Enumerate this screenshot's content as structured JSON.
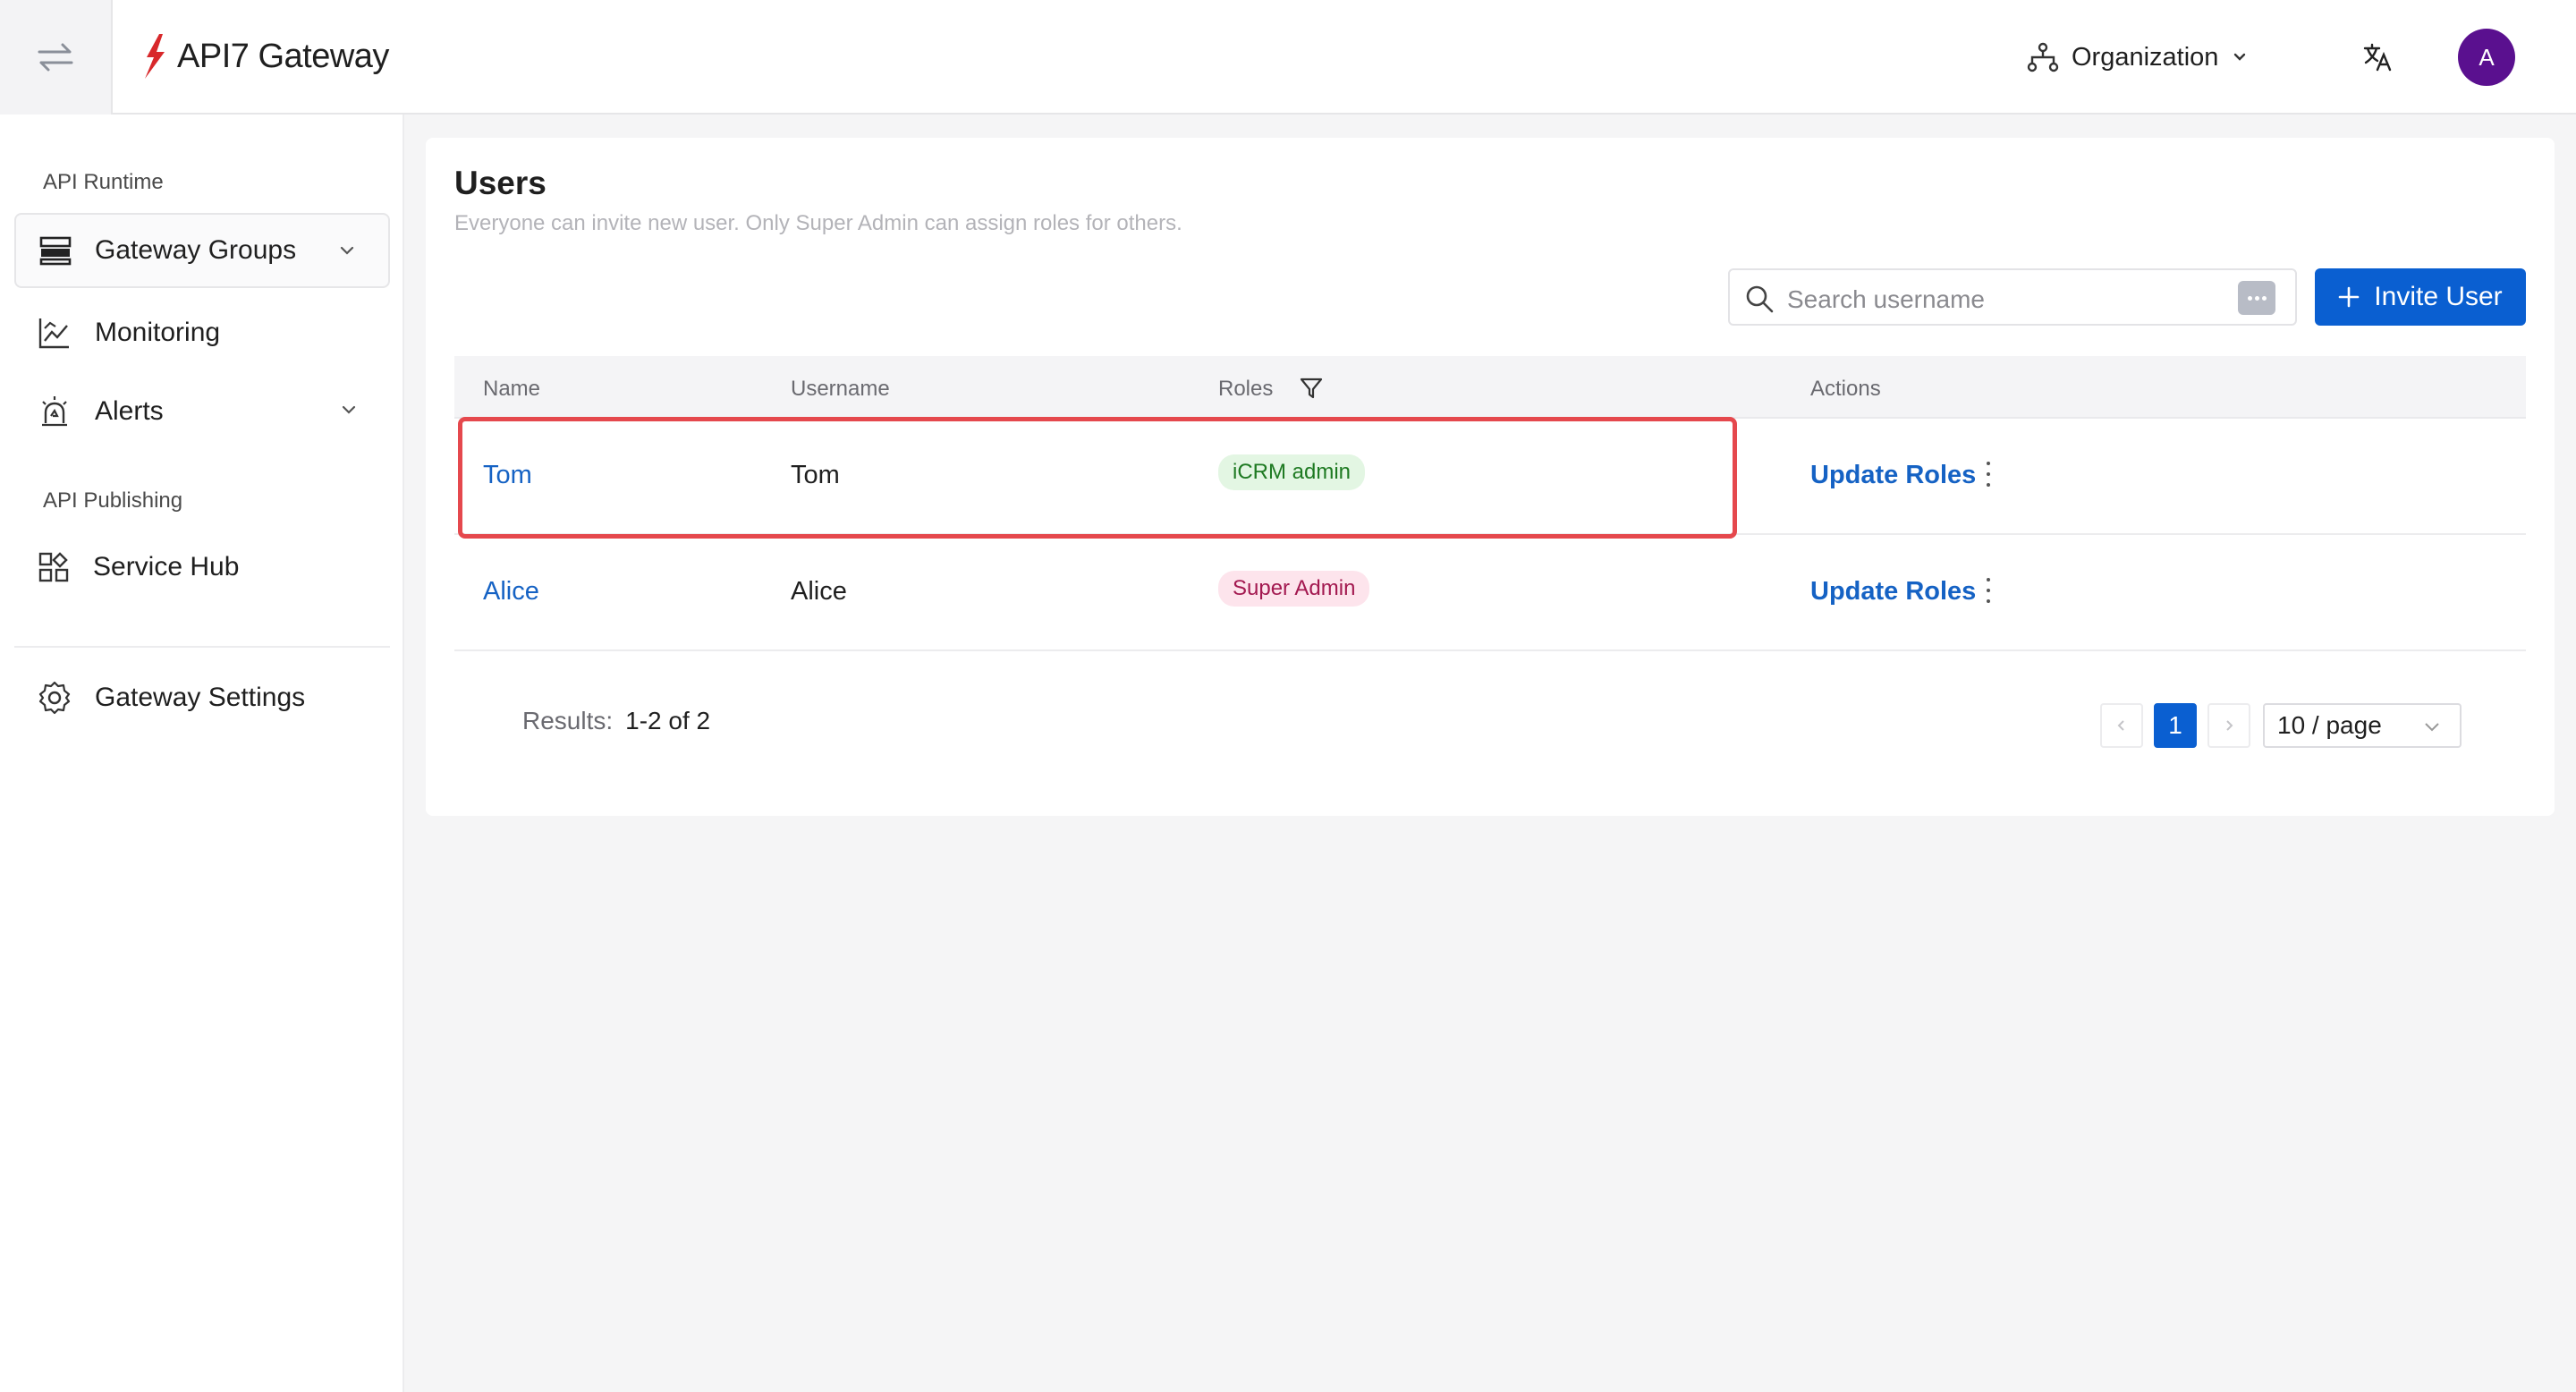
{
  "app": {
    "logo_text": "API7 Gateway",
    "brand_color": "#0a5fd1",
    "highlight_color": "#e5484d"
  },
  "header": {
    "org_label": "Organization",
    "avatar_initial": "A",
    "icons": [
      "swap-arrows-icon",
      "lightning-logo-icon",
      "org-tree-icon",
      "chevron-down-icon",
      "translate-icon"
    ]
  },
  "sidebar": {
    "section_runtime": "API Runtime",
    "section_publishing": "API Publishing",
    "items": [
      {
        "label": "Gateway Groups",
        "icon": "server-icon",
        "expandable": true
      },
      {
        "label": "Monitoring",
        "icon": "chart-icon",
        "expandable": false
      },
      {
        "label": "Alerts",
        "icon": "alarm-icon",
        "expandable": true
      },
      {
        "label": "Service Hub",
        "icon": "grid-icon",
        "expandable": false
      },
      {
        "label": "Gateway Settings",
        "icon": "gear-icon",
        "expandable": false
      }
    ]
  },
  "main": {
    "title": "Users",
    "subtitle": "Everyone can invite new user. Only Super Admin can assign roles for others.",
    "search_placeholder": "Search username",
    "invite_label": "Invite User",
    "columns": [
      "Name",
      "Username",
      "Roles",
      "Actions"
    ],
    "rows": [
      {
        "name": "Tom",
        "username": "Tom",
        "role": "iCRM admin",
        "action": "Update Roles",
        "highlighted": true
      },
      {
        "name": "Alice",
        "username": "Alice",
        "role": "Super Admin",
        "action": "Update Roles",
        "highlighted": false
      }
    ],
    "results_label": "Results:",
    "results_value": "1-2 of 2",
    "current_page": "1",
    "page_size": "10 / page"
  }
}
